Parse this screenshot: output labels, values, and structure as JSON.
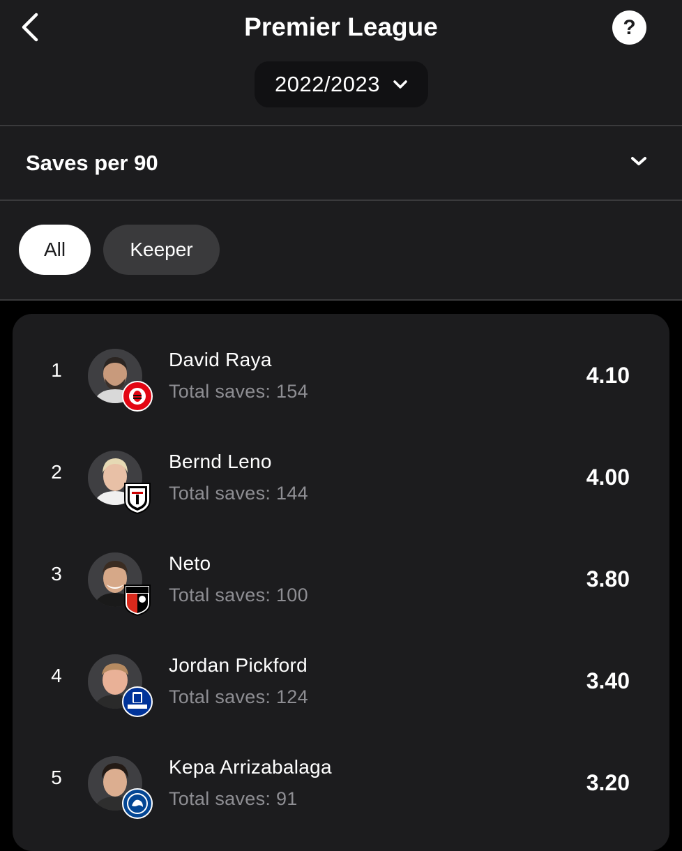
{
  "header": {
    "title": "Premier League",
    "season": "2022/2023",
    "help_label": "?"
  },
  "stat_selector": {
    "label": "Saves per 90"
  },
  "filters": [
    {
      "label": "All",
      "selected": true
    },
    {
      "label": "Keeper",
      "selected": false
    }
  ],
  "rows_label": "Total saves: ",
  "players": [
    {
      "rank": "1",
      "name": "David Raya",
      "total": "Total saves: 154",
      "value": "4.10",
      "club_icon": "brentford-crest-icon",
      "club_color": "#e30613"
    },
    {
      "rank": "2",
      "name": "Bernd Leno",
      "total": "Total saves: 144",
      "value": "4.00",
      "club_icon": "fulham-crest-icon",
      "club_color": "#ffffff"
    },
    {
      "rank": "3",
      "name": "Neto",
      "total": "Total saves: 100",
      "value": "3.80",
      "club_icon": "bournemouth-crest-icon",
      "club_color": "#da291c"
    },
    {
      "rank": "4",
      "name": "Jordan Pickford",
      "total": "Total saves: 124",
      "value": "3.40",
      "club_icon": "everton-crest-icon",
      "club_color": "#003399"
    },
    {
      "rank": "5",
      "name": "Kepa Arrizabalaga",
      "total": "Total saves: 91",
      "value": "3.20",
      "club_icon": "chelsea-crest-icon",
      "club_color": "#034694"
    }
  ],
  "colors": {
    "background": "#000000",
    "panel": "#1c1c1e",
    "muted_text": "#8e8e93",
    "pill_inactive": "#3a3a3c"
  }
}
